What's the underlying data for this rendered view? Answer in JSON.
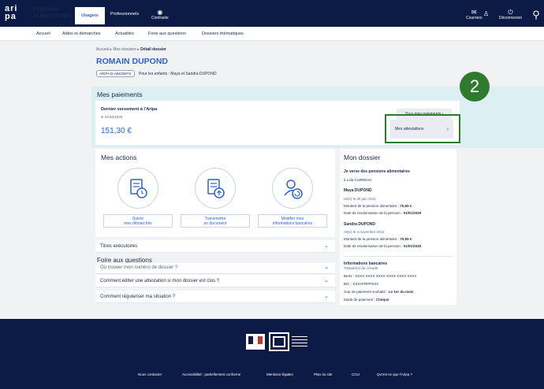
{
  "header": {
    "logo": "ari pa",
    "brand_line1": "PENSIONS",
    "brand_line2": "ALIMENTAIRES",
    "tab_usagers": "Usagers",
    "tab_pro": "Professionnels",
    "contraste": "Contraste",
    "courriers": "Courriers",
    "deconnexion": "Déconnexion"
  },
  "subnav": [
    "Accueil",
    "Aides et démarches",
    "Actualités",
    "Foire aux questions",
    "Dossiers thématiques"
  ],
  "breadcrumb": {
    "home": "Accueil",
    "dossiers": "Mes dossiers",
    "current": "Détail dossier"
  },
  "person": {
    "name": "ROMAIN DUPOND",
    "dossier_id": "ARIPA D-ABCDEFG",
    "children": "Pour les enfants : Maya et Sandra DUPOND"
  },
  "payments": {
    "title": "Mes paiements",
    "last_label": "Dernier versement à l'Aripa",
    "last_date": "le 01/10/2025",
    "amount": "151,30 €",
    "btn_payments": "Tous mes paiements",
    "btn_attestations": "Mes attestations"
  },
  "step_badge": "2",
  "actions": {
    "title": "Mes actions",
    "items": [
      {
        "label_line1": "Suivre",
        "label_line2": "mes démarches"
      },
      {
        "label_line1": "Transmettre",
        "label_line2": "un document"
      },
      {
        "label_line1": "Modifier mes",
        "label_line2": "informations bancaires"
      }
    ]
  },
  "accordions": {
    "titres": "Titres exécutoires",
    "faq_title": "Foire aux questions",
    "q1": "Où trouver mon numéro de dossier ?",
    "q2": "Comment éditer une attestation si mon dossier est clos ?",
    "q3": "Comment régulariser ma situation ?"
  },
  "dossier": {
    "title": "Mon dossier",
    "role": "Je verse des pensions alimentaires",
    "to": "à Lola CARREAU",
    "child1_name": "Maya DUPOND",
    "child1_born": "né(e) le 26 juin 2011",
    "child1_amount_label": "Montant de la pension alimentaire :",
    "child1_amount": "75,65 €",
    "child1_reval_label": "Date de revalorisation de la pension :",
    "child1_reval": "01/01/2025",
    "child2_name": "Sandra DUPOND",
    "child2_born": "né(e) le 4 novembre 2022",
    "child2_amount_label": "Montant de la pension alimentaire :",
    "child2_amount": "75,65 €",
    "child2_reval_label": "Date de revalorisation de la pension :",
    "child2_reval": "01/01/2025",
    "bank_title": "Informations bancaires",
    "holder": "Titulaire(s) du compte",
    "iban": "IBAN : XXXX XXXX XXXX XXXX XXXX XXX4",
    "bic": "BIC : XXXAFRPPXXX",
    "pay_day_label": "Jour de paiement souhaité :",
    "pay_day": "Le 1er du mois",
    "mode_label": "Mode de paiement :",
    "mode": "Chèque"
  },
  "footer": {
    "links": [
      "Nous contacter",
      "Accessibilité : partiellement conforme",
      "Mentions légales",
      "Plan du site",
      "CGU",
      "Qu'est ce que l'Aripa ?"
    ]
  }
}
